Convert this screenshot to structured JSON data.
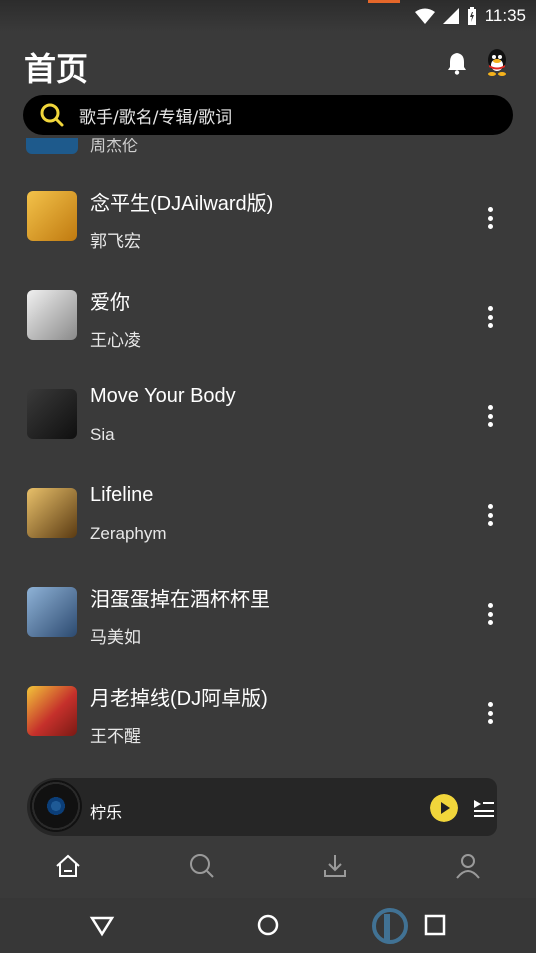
{
  "status": {
    "time": "11:35"
  },
  "header": {
    "title": "首页",
    "icons": [
      "bell-icon",
      "qq-icon"
    ]
  },
  "search": {
    "placeholder": "歌手/歌名/专辑/歌词",
    "icon": "search-icon",
    "accent": "#f1d63b"
  },
  "songs_partial": {
    "artist": "周杰伦"
  },
  "songs": [
    {
      "title": "念平生(DJAilward版)",
      "artist": "郭飞宏",
      "cover": "#d89a20"
    },
    {
      "title": "爱你",
      "artist": "王心凌",
      "cover": "#c9c9c9"
    },
    {
      "title": "Move Your Body",
      "artist": "Sia",
      "cover": "#2a2a2a"
    },
    {
      "title": "Lifeline",
      "artist": "Zeraphym",
      "cover": "#b58a3a"
    },
    {
      "title": "泪蛋蛋掉在酒杯杯里",
      "artist": "马美如",
      "cover": "#5a7fa8"
    },
    {
      "title": "月老掉线(DJ阿卓版)",
      "artist": "王不醒",
      "cover": "#c5302b"
    }
  ],
  "player": {
    "name": "柠乐",
    "play_color": "#f1d63b"
  },
  "tabs": [
    "home-icon",
    "search-icon",
    "download-icon",
    "user-icon"
  ],
  "nav": [
    "back-icon",
    "home-circle-icon",
    "recents-icon"
  ]
}
